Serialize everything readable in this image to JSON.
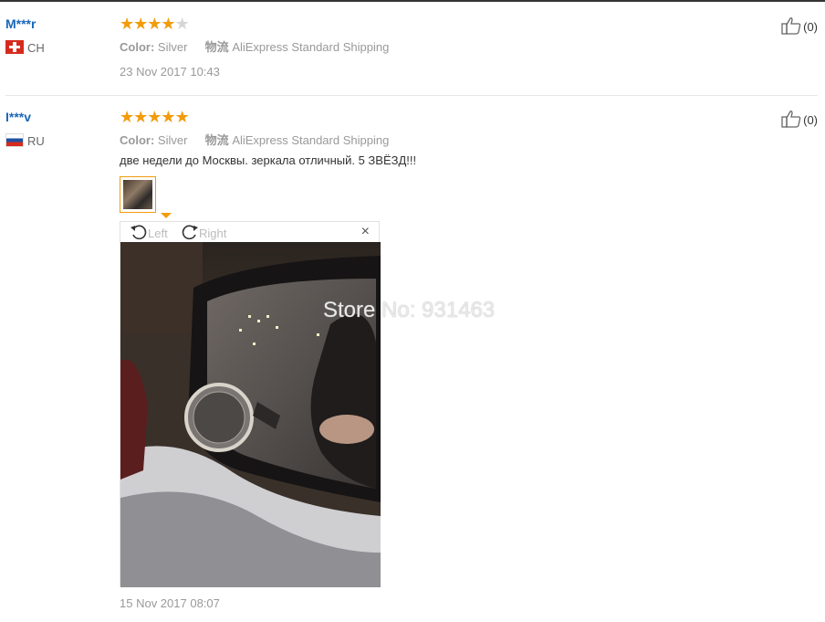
{
  "reviews": [
    {
      "user": "M***r",
      "country": "CH",
      "stars_filled": 4,
      "stars_total": 5,
      "color_label": "Color:",
      "color_value": "Silver",
      "shipping_label": "物流",
      "shipping_value": "AliExpress Standard Shipping",
      "date": "23 Nov 2017 10:43",
      "likes": "(0)"
    },
    {
      "user": "I***v",
      "country": "RU",
      "stars_filled": 5,
      "stars_total": 5,
      "color_label": "Color:",
      "color_value": "Silver",
      "shipping_label": "物流",
      "shipping_value": "AliExpress Standard Shipping",
      "feedback": "две недели до Москвы. зеркала отличный. 5 ЗВЁЗД!!!",
      "date": "15 Nov 2017 08:07",
      "likes": "(0)"
    }
  ],
  "viewer": {
    "rotate_left": "Left",
    "rotate_right": "Right",
    "close": "×"
  },
  "watermark": "Store No: 931463",
  "colors": {
    "star": "#f29b0c",
    "user_link": "#1a66b8",
    "muted": "#999999"
  }
}
